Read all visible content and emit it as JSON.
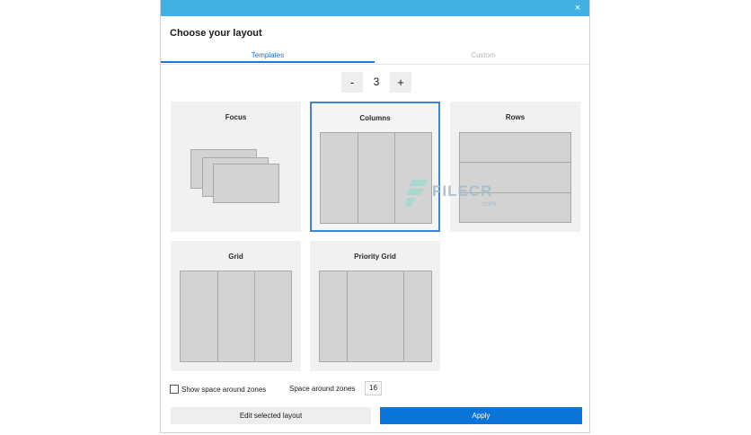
{
  "dialog": {
    "title": "Choose your layout",
    "close_glyph": "×"
  },
  "tabs": [
    {
      "label": "Templates",
      "active": true
    },
    {
      "label": "Custom",
      "active": false
    }
  ],
  "stepper": {
    "minus_label": "-",
    "value": "3",
    "plus_label": "+"
  },
  "layouts": [
    {
      "label": "Focus",
      "selected": false
    },
    {
      "label": "Columns",
      "selected": true
    },
    {
      "label": "Rows",
      "selected": false
    },
    {
      "label": "Grid",
      "selected": false
    },
    {
      "label": "Priority Grid",
      "selected": false
    }
  ],
  "options": {
    "show_space_label": "Show space around zones",
    "show_space_checked": false,
    "space_label": "Space around zones",
    "space_value": "16"
  },
  "buttons": {
    "edit_label": "Edit selected layout",
    "apply_label": "Apply"
  },
  "watermark": {
    "text": "FILECR",
    "sub": ".com"
  },
  "colors": {
    "titlebar": "#41b0e2",
    "accent": "#1e78d2",
    "apply": "#0a74d8",
    "zone": "#d3d3d3"
  }
}
